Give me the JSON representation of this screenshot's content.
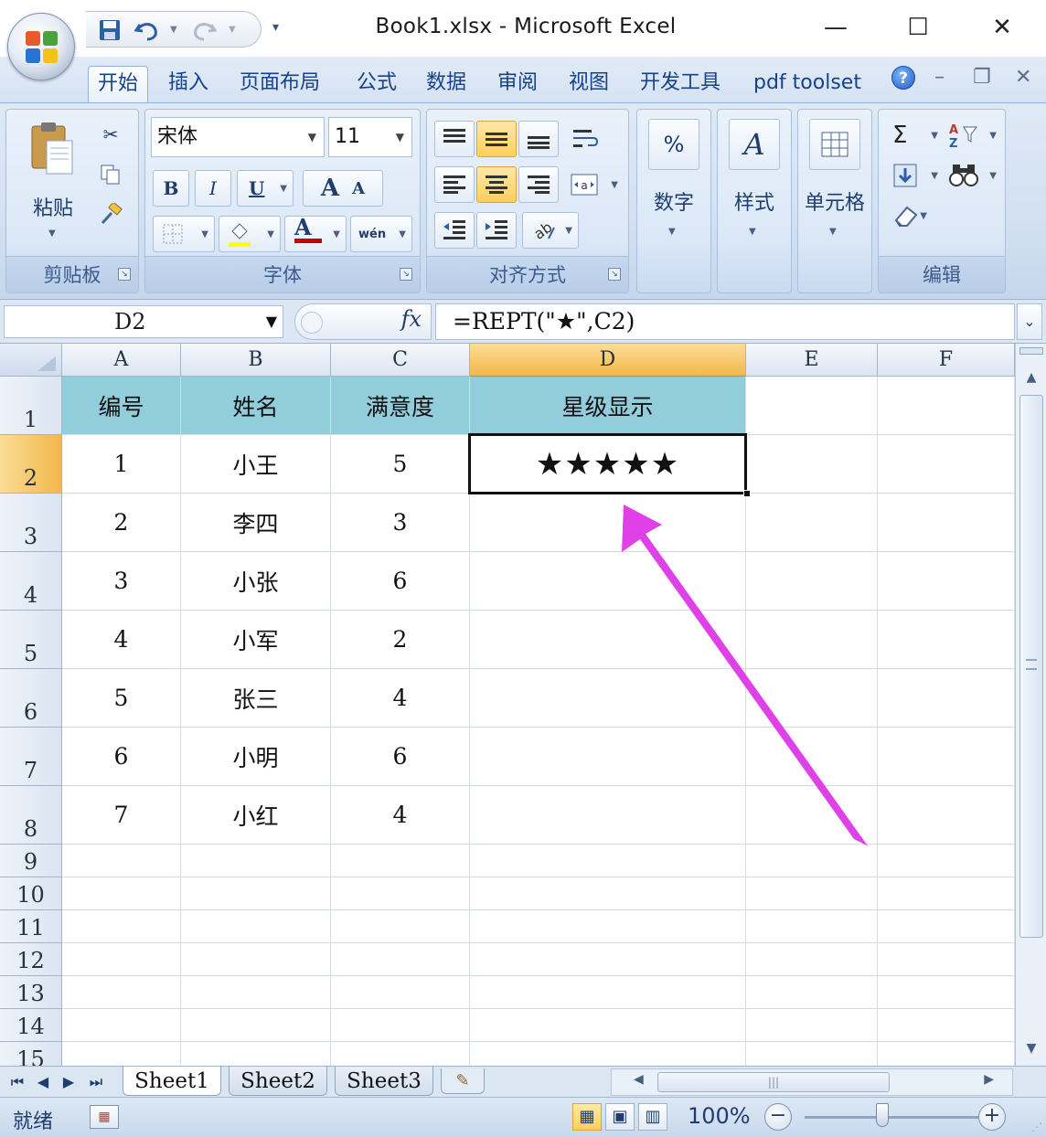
{
  "window": {
    "title": "Book1.xlsx  -  Microsoft Excel",
    "controls": {
      "minimize": "—",
      "maximize": "☐",
      "close": "✕"
    }
  },
  "quick_access": {
    "customize": "▾"
  },
  "ribbon": {
    "tabs": [
      {
        "label": "开始",
        "active": true
      },
      {
        "label": "插入",
        "active": false
      },
      {
        "label": "页面布局",
        "active": false
      },
      {
        "label": "公式",
        "active": false
      },
      {
        "label": "数据",
        "active": false
      },
      {
        "label": "审阅",
        "active": false
      },
      {
        "label": "视图",
        "active": false
      },
      {
        "label": "开发工具",
        "active": false
      },
      {
        "label": "pdf toolset",
        "active": false
      }
    ],
    "help": "?",
    "doc_controls": {
      "minimize": "–",
      "restore": "❐",
      "close": "✕"
    },
    "clipboard": {
      "group_label": "剪贴板",
      "paste_label": "粘贴"
    },
    "font": {
      "group_label": "字体",
      "font_name": "宋体",
      "font_size": "11",
      "bold": "B",
      "italic": "I",
      "underline": "U",
      "grow": "A",
      "shrink": "A",
      "font_color": "A",
      "phonetic": "wén"
    },
    "alignment": {
      "group_label": "对齐方式"
    },
    "number": {
      "label": "数字",
      "icon_text": "%"
    },
    "styles": {
      "label": "样式"
    },
    "cells": {
      "label": "单元格"
    },
    "editing": {
      "group_label": "编辑",
      "sum": "Σ"
    }
  },
  "formula_bar": {
    "name_box": "D2",
    "fx": "fx",
    "formula": "=REPT(\"★\",C2)"
  },
  "sheet": {
    "columns": [
      "A",
      "B",
      "C",
      "D",
      "E",
      "F"
    ],
    "selected_column": "D",
    "selected_row": 2,
    "row_numbers": [
      "1",
      "2",
      "3",
      "4",
      "5",
      "6",
      "7",
      "8",
      "9",
      "10",
      "11",
      "12",
      "13",
      "14",
      "15"
    ],
    "header_fill_color": "#92cddc",
    "headers": [
      "编号",
      "姓名",
      "满意度",
      "星级显示"
    ],
    "rows": [
      {
        "id": "1",
        "name": "小王",
        "score": "5",
        "stars": "★★★★★"
      },
      {
        "id": "2",
        "name": "李四",
        "score": "3",
        "stars": ""
      },
      {
        "id": "3",
        "name": "小张",
        "score": "6",
        "stars": ""
      },
      {
        "id": "4",
        "name": "小军",
        "score": "2",
        "stars": ""
      },
      {
        "id": "5",
        "name": "张三",
        "score": "4",
        "stars": ""
      },
      {
        "id": "6",
        "name": "小明",
        "score": "6",
        "stars": ""
      },
      {
        "id": "7",
        "name": "小红",
        "score": "4",
        "stars": ""
      }
    ],
    "annotation_arrow_color": "#e040e8"
  },
  "sheet_tabs": {
    "tabs": [
      "Sheet1",
      "Sheet2",
      "Sheet3"
    ],
    "active": "Sheet1"
  },
  "status_bar": {
    "status": "就绪",
    "zoom": "100%",
    "zoom_out": "−",
    "zoom_in": "+"
  }
}
